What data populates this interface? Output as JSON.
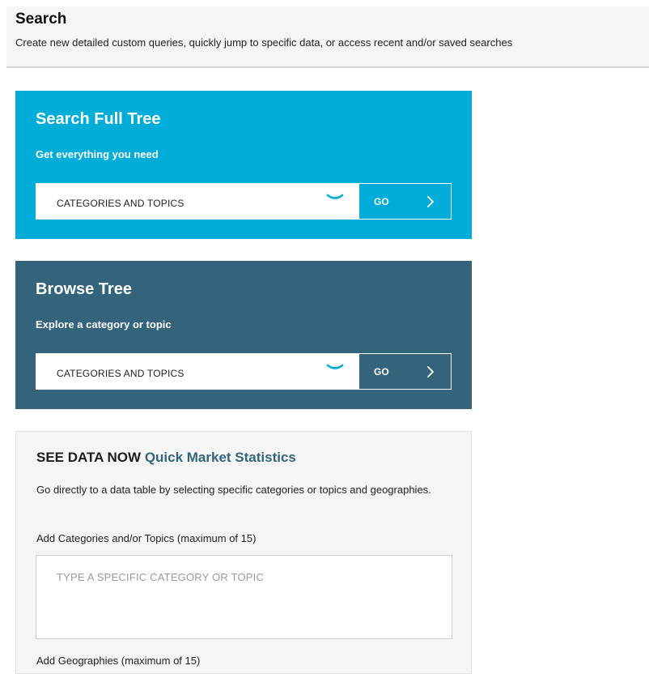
{
  "header": {
    "title": "Search",
    "subtitle": "Create new detailed custom queries, quickly jump to specific data, or access recent and/or saved searches"
  },
  "search_full_tree": {
    "title": "Search Full Tree",
    "subtitle": "Get everything you need",
    "dropdown_value": "CATEGORIES AND TOPICS",
    "go_label": "GO",
    "background_color": "#00acd8"
  },
  "browse_tree": {
    "title": "Browse Tree",
    "subtitle": "Explore a category or topic",
    "dropdown_value": "CATEGORIES AND TOPICS",
    "go_label": "GO",
    "background_color": "#33647c"
  },
  "quick_stats": {
    "title_prefix": "SEE DATA NOW",
    "title_accent": "Quick Market Statistics",
    "description": "Go directly to a data table by selecting specific categories or topics and geographies.",
    "categories_label": "Add Categories and/or Topics (maximum of 15)",
    "categories_placeholder": "TYPE A SPECIFIC CATEGORY OR TOPIC",
    "geographies_label": "Add Geographies (maximum of 15)"
  },
  "icons": {
    "dropdown": "chevron-down-icon",
    "go": "chevron-right-icon"
  }
}
